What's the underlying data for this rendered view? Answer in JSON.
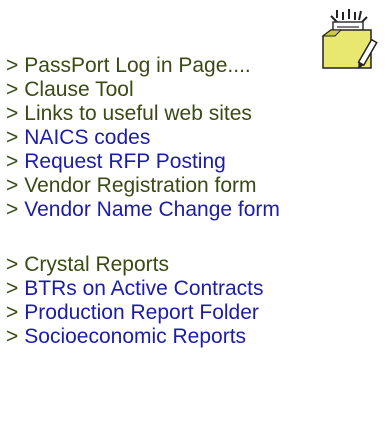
{
  "icon": {
    "name": "folder-document-icon",
    "color": "#e8e870"
  },
  "colors": {
    "olive_text": "#3a4a14",
    "blue_link": "#1c1ca8"
  },
  "arrow_glyph": ">",
  "group1": [
    {
      "label": "PassPort Log in Page....",
      "color": "olive"
    },
    {
      "label": "Clause Tool",
      "color": "olive"
    },
    {
      "label": "Links to useful web sites",
      "color": "olive"
    },
    {
      "label": "NAICS codes",
      "color": "blue"
    },
    {
      "label": "Request RFP Posting",
      "color": "blue"
    },
    {
      "label": "Vendor Registration form",
      "color": "olive"
    },
    {
      "label": "Vendor Name Change form",
      "color": "blue"
    }
  ],
  "group2": [
    {
      "label": "Crystal Reports",
      "color": "olive"
    },
    {
      "label": "BTRs on Active Contracts",
      "color": "blue"
    },
    {
      "label": "Production Report Folder",
      "color": "blue"
    },
    {
      "label": "Socioeconomic Reports",
      "color": "blue"
    }
  ]
}
